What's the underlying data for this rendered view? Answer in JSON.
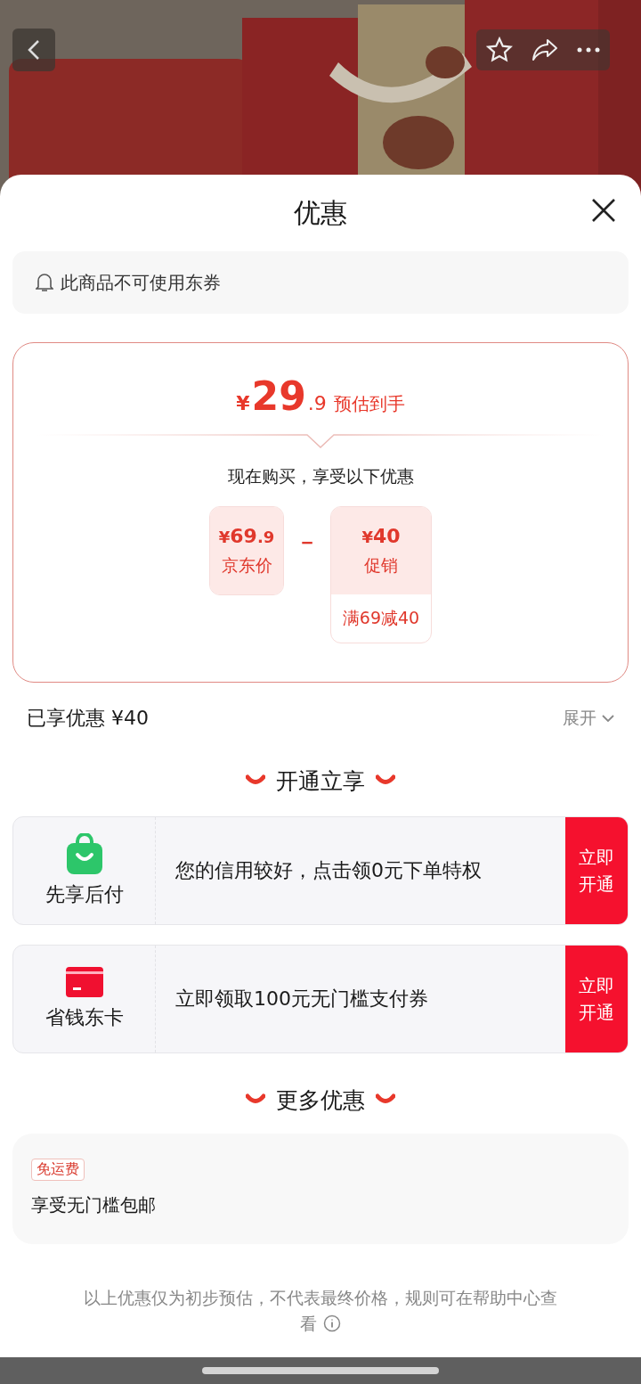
{
  "header": {
    "title": "优惠"
  },
  "notice": {
    "text": "此商品不可使用东券"
  },
  "estimate": {
    "currency": "¥",
    "integer": "29",
    "decimal": ".9",
    "label": "预估到手",
    "subtitle": "现在购买，享受以下优惠",
    "operator": "－",
    "terms": [
      {
        "currency": "¥",
        "integer": "69",
        "decimal": ".9",
        "label": "京东价"
      },
      {
        "currency": "¥",
        "integer": "40",
        "label": "促销",
        "detail": "满69减40"
      }
    ]
  },
  "summary": {
    "text": "已享优惠 ¥40",
    "toggle": "展开"
  },
  "sections": [
    {
      "title": "开通立享",
      "offers": [
        {
          "kind": "bag",
          "name": "先享后付",
          "text": "您的信用较好，点击领0元下单特权",
          "button": "立即开通"
        },
        {
          "kind": "card",
          "name": "省钱东卡",
          "text": "立即领取100元无门槛支付券",
          "button": "立即开通"
        }
      ]
    },
    {
      "title": "更多优惠",
      "perks": [
        {
          "tag": "免运费",
          "text": "享受无门槛包邮"
        }
      ]
    }
  ],
  "footer": {
    "text": "以上优惠仅为初步预估，不代表最终价格，规则可在帮助中心查看"
  }
}
